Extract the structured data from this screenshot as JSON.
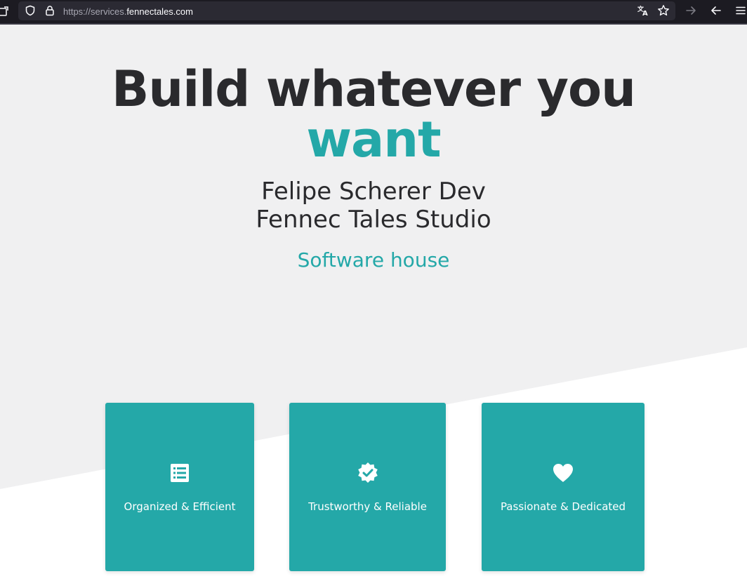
{
  "browser": {
    "url_prefix": "https://services.",
    "url_domain": "fennectales.com",
    "icons": {
      "left_edge": "extension-icon",
      "tracking": "shield-icon",
      "security": "lock-icon",
      "translate": "translate-icon",
      "bookmark": "star-icon",
      "forward": "arrow-right-icon",
      "back": "arrow-left-icon",
      "menu": "hamburger-menu-icon"
    }
  },
  "hero": {
    "headline_line1": "Build whatever you",
    "headline_line2": "want",
    "subtitle_line1": "Felipe Scherer Dev",
    "subtitle_line2": "Fennec Tales Studio",
    "tagline": "Software house"
  },
  "features": [
    {
      "label": "Organized & Efficient",
      "icon": "list-icon"
    },
    {
      "label": "Trustworthy & Reliable",
      "icon": "verified-badge-icon"
    },
    {
      "label": "Passionate & Dedicated",
      "icon": "heart-icon"
    }
  ],
  "colors": {
    "accent": "#24a8a8",
    "text_dark": "#2a2a2d",
    "hero_background": "#f0f0f1",
    "page_background": "#ffffff",
    "browser_chrome": "#1c1b22",
    "urlbar": "#2b2a33"
  }
}
